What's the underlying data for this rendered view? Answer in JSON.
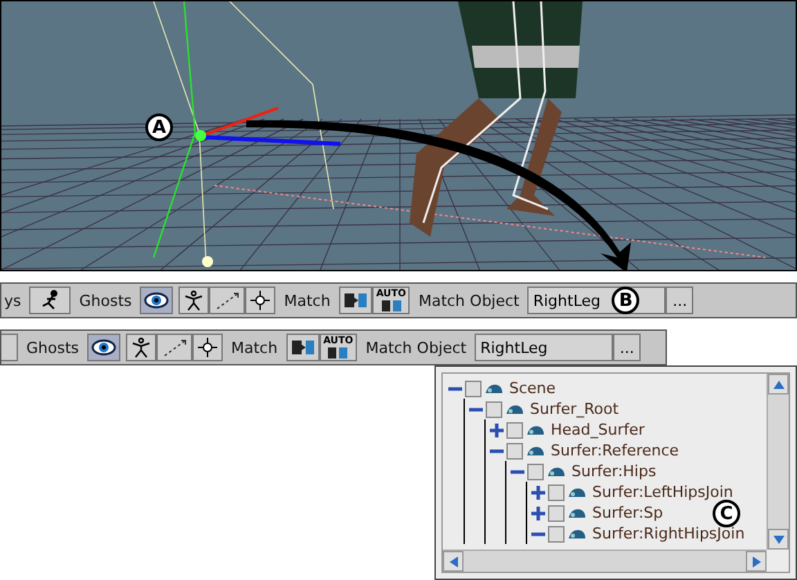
{
  "viewport": {
    "callout": "A"
  },
  "toolbars": [
    {
      "leading": [
        {
          "kind": "text",
          "label": "ys"
        },
        {
          "kind": "run"
        }
      ],
      "ghosts_label": "Ghosts",
      "ghost_buttons": [
        {
          "kind": "eye",
          "selected": true
        },
        {
          "kind": "figure",
          "selected": false
        },
        {
          "kind": "trail",
          "selected": false
        },
        {
          "kind": "target",
          "selected": false
        }
      ],
      "match_label": "Match",
      "match_buttons": [
        {
          "kind": "match"
        },
        {
          "kind": "auto",
          "label": "AUTO"
        }
      ],
      "match_object_label": "Match Object",
      "match_object_value": "RightLeg",
      "browse_button": "...",
      "callout": "B"
    },
    {
      "leading": [
        {
          "kind": "blank"
        }
      ],
      "ghosts_label": "Ghosts",
      "ghost_buttons": [
        {
          "kind": "eye",
          "selected": true
        },
        {
          "kind": "figure",
          "selected": false
        },
        {
          "kind": "trail",
          "selected": false
        },
        {
          "kind": "target",
          "selected": false
        }
      ],
      "match_label": "Match",
      "match_buttons": [
        {
          "kind": "match"
        },
        {
          "kind": "auto",
          "label": "AUTO"
        }
      ],
      "match_object_label": "Match Object",
      "match_object_value": "RightLeg",
      "browse_button": "..."
    }
  ],
  "tree": {
    "callout": "C",
    "items": [
      {
        "label": "Scene",
        "expanded": true,
        "checked": false,
        "children": [
          {
            "label": "Surfer_Root",
            "expanded": true,
            "checked": false,
            "children": [
              {
                "label": "Head_Surfer",
                "expanded": false,
                "checked": false
              },
              {
                "label": "Surfer:Reference",
                "expanded": true,
                "checked": false,
                "children": [
                  {
                    "label": "Surfer:Hips",
                    "expanded": true,
                    "checked": false,
                    "children": [
                      {
                        "label": "Surfer:LeftHipsJoin",
                        "expanded": false,
                        "checked": false
                      },
                      {
                        "label": "Surfer:Sp",
                        "expanded": false,
                        "checked": false
                      },
                      {
                        "label": "Surfer:RightHipsJoin",
                        "expanded": true,
                        "checked": false
                      }
                    ]
                  }
                ]
              }
            ]
          }
        ]
      }
    ]
  }
}
